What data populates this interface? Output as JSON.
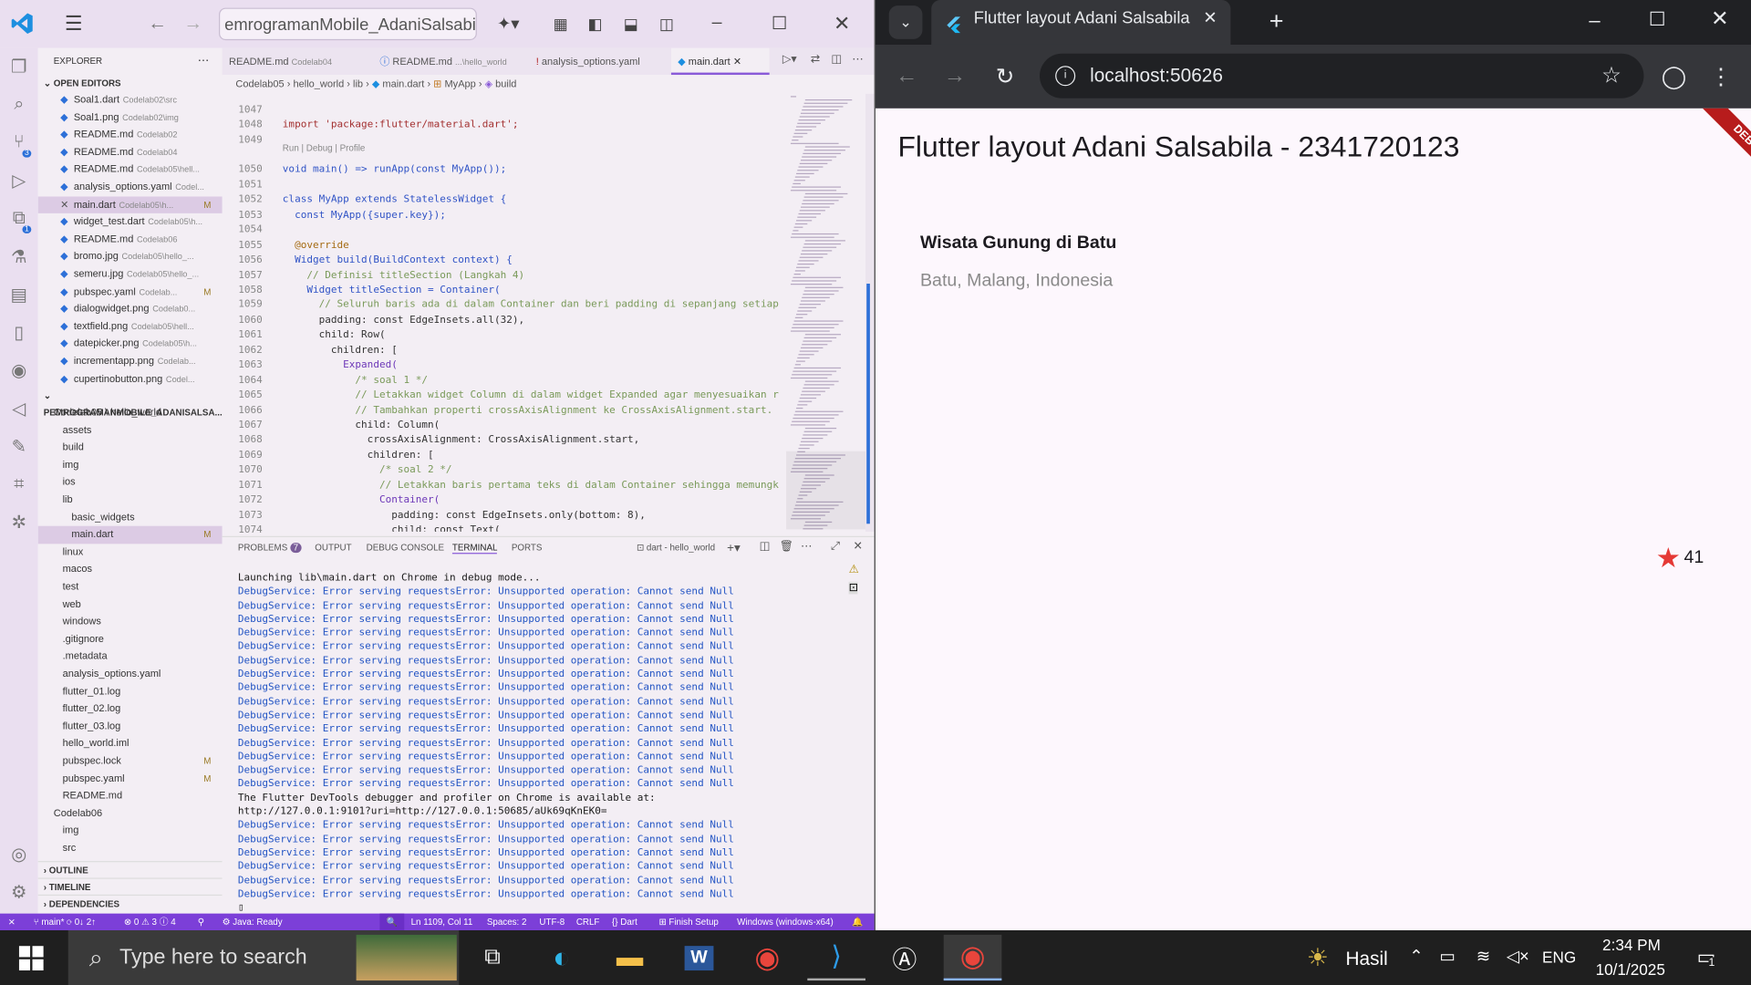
{
  "vscode": {
    "title_search": "emrogramanMobile_AdaniSalsabila",
    "explorer_header": "EXPLORER",
    "open_editors_header": "OPEN EDITORS",
    "open_editors": [
      {
        "name": "Soal1.dart",
        "desc": "Codelab02\\src",
        "mod": ""
      },
      {
        "name": "Soal1.png",
        "desc": "Codelab02\\img",
        "mod": ""
      },
      {
        "name": "README.md",
        "desc": "Codelab02",
        "mod": ""
      },
      {
        "name": "README.md",
        "desc": "Codelab04",
        "mod": ""
      },
      {
        "name": "README.md",
        "desc": "Codelab05\\hell...",
        "mod": ""
      },
      {
        "name": "analysis_options.yaml",
        "desc": "Codel...",
        "mod": ""
      },
      {
        "name": "main.dart",
        "desc": "Codelab05\\h...",
        "mod": "M"
      },
      {
        "name": "widget_test.dart",
        "desc": "Codelab05\\h...",
        "mod": ""
      },
      {
        "name": "README.md",
        "desc": "Codelab06",
        "mod": ""
      },
      {
        "name": "bromo.jpg",
        "desc": "Codelab05\\hello_...",
        "mod": ""
      },
      {
        "name": "semeru.jpg",
        "desc": "Codelab05\\hello_...",
        "mod": ""
      },
      {
        "name": "pubspec.yaml",
        "desc": "Codelab...",
        "mod": "M"
      },
      {
        "name": "dialogwidget.png",
        "desc": "Codelab0...",
        "mod": ""
      },
      {
        "name": "textfield.png",
        "desc": "Codelab05\\hell...",
        "mod": ""
      },
      {
        "name": "datepicker.png",
        "desc": "Codelab05\\h...",
        "mod": ""
      },
      {
        "name": "incrementapp.png",
        "desc": "Codelab...",
        "mod": ""
      },
      {
        "name": "cupertinobutton.png",
        "desc": "Codel...",
        "mod": ""
      }
    ],
    "workspace_header": "PEMROGRAMANMOBILE_ADANISALSA...",
    "tree": [
      {
        "name": "Codelab05 \\ hello_world",
        "indent": 0,
        "mod": ""
      },
      {
        "name": "assets",
        "indent": 1,
        "mod": ""
      },
      {
        "name": "build",
        "indent": 1,
        "mod": ""
      },
      {
        "name": "img",
        "indent": 1,
        "mod": ""
      },
      {
        "name": "ios",
        "indent": 1,
        "mod": ""
      },
      {
        "name": "lib",
        "indent": 1,
        "mod": ""
      },
      {
        "name": "basic_widgets",
        "indent": 2,
        "mod": ""
      },
      {
        "name": "main.dart",
        "indent": 2,
        "mod": "M"
      },
      {
        "name": "linux",
        "indent": 1,
        "mod": ""
      },
      {
        "name": "macos",
        "indent": 1,
        "mod": ""
      },
      {
        "name": "test",
        "indent": 1,
        "mod": ""
      },
      {
        "name": "web",
        "indent": 1,
        "mod": ""
      },
      {
        "name": "windows",
        "indent": 1,
        "mod": ""
      },
      {
        "name": ".gitignore",
        "indent": 1,
        "mod": ""
      },
      {
        "name": ".metadata",
        "indent": 1,
        "mod": ""
      },
      {
        "name": "analysis_options.yaml",
        "indent": 1,
        "mod": ""
      },
      {
        "name": "flutter_01.log",
        "indent": 1,
        "mod": ""
      },
      {
        "name": "flutter_02.log",
        "indent": 1,
        "mod": ""
      },
      {
        "name": "flutter_03.log",
        "indent": 1,
        "mod": ""
      },
      {
        "name": "hello_world.iml",
        "indent": 1,
        "mod": ""
      },
      {
        "name": "pubspec.lock",
        "indent": 1,
        "mod": "M"
      },
      {
        "name": "pubspec.yaml",
        "indent": 1,
        "mod": "M"
      },
      {
        "name": "README.md",
        "indent": 1,
        "mod": ""
      },
      {
        "name": "Codelab06",
        "indent": 0,
        "mod": ""
      },
      {
        "name": "img",
        "indent": 1,
        "mod": ""
      },
      {
        "name": "src",
        "indent": 1,
        "mod": ""
      }
    ],
    "outline": "OUTLINE",
    "timeline": "TIMELINE",
    "dependencies": "DEPENDENCIES",
    "tabs": [
      {
        "label": "README.md",
        "desc": "Codelab04"
      },
      {
        "label": "README.md",
        "desc": "...\\hello_world"
      },
      {
        "label": "analysis_options.yaml",
        "desc": ""
      },
      {
        "label": "main.dart",
        "desc": ""
      }
    ],
    "breadcrumb": [
      "Codelab05",
      "hello_world",
      "lib",
      "main.dart",
      "MyApp",
      "build"
    ],
    "codelens": "Run | Debug | Profile",
    "line_numbers": [
      "1047",
      "1048",
      "1049",
      "1050",
      "1051",
      "1052",
      "1053",
      "1054",
      "1055",
      "1056",
      "1057",
      "1058",
      "1059",
      "1060",
      "1061",
      "1062",
      "1063",
      "1064",
      "1065",
      "1066",
      "1067",
      "1068",
      "1069",
      "1070",
      "1071",
      "1072",
      "1073",
      "1074"
    ],
    "code_lines": [
      "",
      "import 'package:flutter/material.dart';",
      "",
      "void main() => runApp(const MyApp());",
      "",
      "class MyApp extends StatelessWidget {",
      "  const MyApp({super.key});",
      "",
      "  @override",
      "  Widget build(BuildContext context) {",
      "    // Definisi titleSection (Langkah 4)",
      "    Widget titleSection = Container(",
      "      // Seluruh baris ada di dalam Container dan beri padding di sepanjang setiap",
      "      padding: const EdgeInsets.all(32),",
      "      child: Row(",
      "        children: [",
      "          Expanded(",
      "            /* soal 1 */",
      "            // Letakkan widget Column di dalam widget Expanded agar menyesuaikan r",
      "            // Tambahkan properti crossAxisAlignment ke CrossAxisAlignment.start.",
      "            child: Column(",
      "              crossAxisAlignment: CrossAxisAlignment.start,",
      "              children: [",
      "                /* soal 2 */",
      "                // Letakkan baris pertama teks di dalam Container sehingga memungk",
      "                Container(",
      "                  padding: const EdgeInsets.only(bottom: 8),",
      "                  child: const Text("
    ],
    "panel_tabs": {
      "problems": "PROBLEMS",
      "problems_count": "7",
      "output": "OUTPUT",
      "debug": "DEBUG CONSOLE",
      "terminal": "TERMINAL",
      "ports": "PORTS",
      "session": "dart - hello_world"
    },
    "terminal": {
      "launch": "Launching lib\\main.dart on Chrome in debug mode...",
      "error": "DebugService: Error serving requestsError: Unsupported operation: Cannot send Null",
      "devtools1": "The Flutter DevTools debugger and profiler on Chrome is available at:",
      "devtools2": "http://127.0.0.1:9101?uri=http://127.0.0.1:50685/aUk69qKnEK0="
    },
    "status": {
      "branch": "main*",
      "sync": "0↓ 2↑",
      "problems": "⊗ 0 ⚠ 3 ⓘ 4",
      "java": "Java: Ready",
      "position": "Ln 1109, Col 11",
      "spaces": "Spaces: 2",
      "encoding": "UTF-8",
      "eol": "CRLF",
      "lang": "Dart",
      "finish": "Finish Setup",
      "device": "Windows (windows-x64)"
    },
    "activity_badges": {
      "scm": "3",
      "ext": "1"
    }
  },
  "chrome": {
    "tab_title": "Flutter layout Adani Salsabila",
    "url": "localhost:50626",
    "app": {
      "appbar_title": "Flutter layout Adani Salsabila - 2341720123",
      "place_name": "Wisata Gunung di Batu",
      "place_location": "Batu, Malang, Indonesia",
      "star_count": "41",
      "debug_banner": "DEBUG"
    },
    "colors": {
      "star": "#e53935",
      "banner": "#b71c1c"
    }
  },
  "taskbar": {
    "search_placeholder": "Type here to search",
    "weather": "Hasil",
    "lang": "ENG",
    "time": "2:34 PM",
    "date": "10/1/2025",
    "notif_count": "1"
  }
}
